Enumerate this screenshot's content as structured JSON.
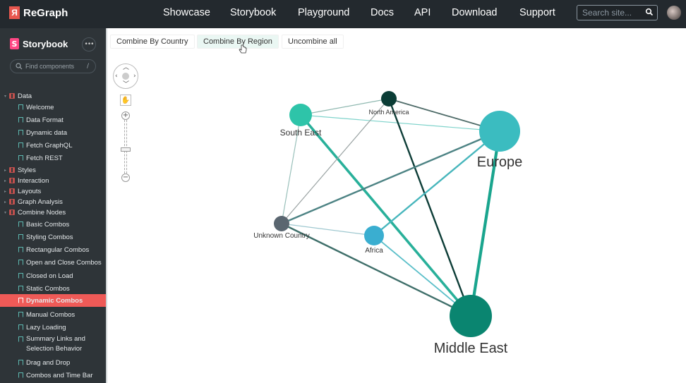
{
  "topbar": {
    "logo_mark": "Я",
    "logo_text": "ReGraph",
    "nav": [
      "Showcase",
      "Storybook",
      "Playground",
      "Docs",
      "API",
      "Download",
      "Support"
    ],
    "search_placeholder": "Search site...",
    "search_icon": "search-icon",
    "avatar": "user-avatar"
  },
  "sidebar": {
    "logo_mark": "S",
    "title": "Storybook",
    "menu_label": "•••",
    "search_placeholder": "Find components",
    "search_shortcut": "/",
    "items": [
      {
        "type": "group",
        "label": "Data",
        "expanded": true
      },
      {
        "type": "leaf",
        "label": "Welcome"
      },
      {
        "type": "leaf",
        "label": "Data Format"
      },
      {
        "type": "leaf",
        "label": "Dynamic data"
      },
      {
        "type": "leaf",
        "label": "Fetch GraphQL"
      },
      {
        "type": "leaf",
        "label": "Fetch REST"
      },
      {
        "type": "group",
        "label": "Styles",
        "expanded": false
      },
      {
        "type": "group",
        "label": "Interaction",
        "expanded": false
      },
      {
        "type": "group",
        "label": "Layouts",
        "expanded": false
      },
      {
        "type": "group",
        "label": "Graph Analysis",
        "expanded": false
      },
      {
        "type": "group",
        "label": "Combine Nodes",
        "expanded": true
      },
      {
        "type": "leaf",
        "label": "Basic Combos"
      },
      {
        "type": "leaf",
        "label": "Styling Combos"
      },
      {
        "type": "leaf",
        "label": "Rectangular Combos"
      },
      {
        "type": "leaf",
        "label": "Open and Close Combos"
      },
      {
        "type": "leaf",
        "label": "Closed on Load"
      },
      {
        "type": "leaf",
        "label": "Static Combos"
      },
      {
        "type": "leaf",
        "label": "Dynamic Combos",
        "active": true
      },
      {
        "type": "leaf",
        "label": "Manual Combos"
      },
      {
        "type": "leaf",
        "label": "Lazy Loading"
      },
      {
        "type": "leaf",
        "label": "Summary Links and Selection Behavior"
      },
      {
        "type": "leaf",
        "label": "Drag and Drop"
      },
      {
        "type": "leaf",
        "label": "Combos and Time Bar"
      }
    ]
  },
  "toolbar": {
    "buttons": [
      "Combine By Country",
      "Combine By Region",
      "Uncombine all"
    ],
    "hovered": "Combine By Region"
  },
  "controls": {
    "zoom_in": "+",
    "zoom_out": "−",
    "zoom_level_fraction": 0.55
  },
  "graph": {
    "nodes": [
      {
        "id": "south-east",
        "label": "South East",
        "color": "#2ec4a9",
        "size": "small"
      },
      {
        "id": "north-america",
        "label": "North America",
        "color": "#0b3d36",
        "size": "tiny"
      },
      {
        "id": "europe",
        "label": "Europe",
        "color": "#3bbcc0",
        "size": "large"
      },
      {
        "id": "unknown-country",
        "label": "Unknown Country",
        "color": "#5a6670",
        "size": "tiny"
      },
      {
        "id": "africa",
        "label": "Africa",
        "color": "#3aaed0",
        "size": "small"
      },
      {
        "id": "middle-east",
        "label": "Middle East",
        "color": "#0a8570",
        "size": "large"
      }
    ],
    "links": [
      {
        "from": "south-east",
        "to": "north-america",
        "color": "#8fb8b0",
        "weight": 1
      },
      {
        "from": "south-east",
        "to": "europe",
        "color": "#7fd3cb",
        "weight": 1
      },
      {
        "from": "south-east",
        "to": "unknown-country",
        "color": "#99c0ba",
        "weight": 1
      },
      {
        "from": "south-east",
        "to": "middle-east",
        "color": "#29b09a",
        "weight": 3
      },
      {
        "from": "north-america",
        "to": "europe",
        "color": "#4e6b68",
        "weight": 1.5
      },
      {
        "from": "north-america",
        "to": "unknown-country",
        "color": "#9aa3a3",
        "weight": 1
      },
      {
        "from": "north-america",
        "to": "middle-east",
        "color": "#0d3d37",
        "weight": 2
      },
      {
        "from": "europe",
        "to": "unknown-country",
        "color": "#4d8384",
        "weight": 2
      },
      {
        "from": "europe",
        "to": "africa",
        "color": "#47b6bc",
        "weight": 2
      },
      {
        "from": "europe",
        "to": "middle-east",
        "color": "#1aa58e",
        "weight": 3.5
      },
      {
        "from": "unknown-country",
        "to": "africa",
        "color": "#9fc8d0",
        "weight": 1
      },
      {
        "from": "unknown-country",
        "to": "middle-east",
        "color": "#3f6f6a",
        "weight": 2
      },
      {
        "from": "africa",
        "to": "middle-east",
        "color": "#5bbfc9",
        "weight": 1.5
      }
    ]
  }
}
